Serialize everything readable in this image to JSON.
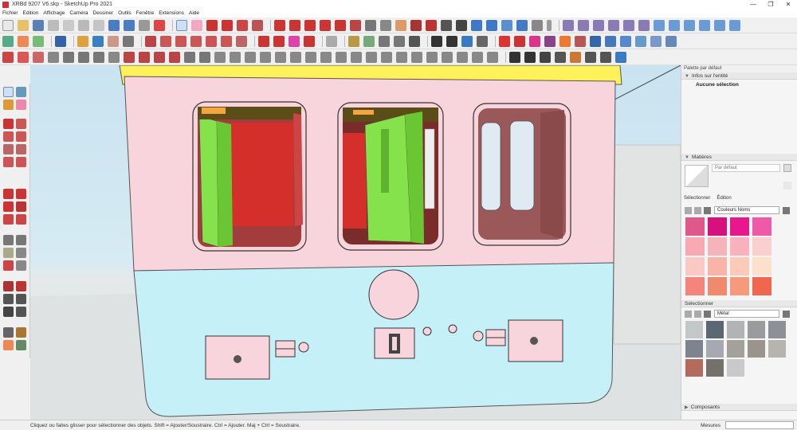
{
  "window": {
    "title": "XRBd 9207 V6.skp - SketchUp Pro 2021",
    "min": "—",
    "max": "❐",
    "close": "✕"
  },
  "menu": [
    "Fichier",
    "Edition",
    "Affichage",
    "Caméra",
    "Dessiner",
    "Outils",
    "Fenêtre",
    "Extensions",
    "Aide"
  ],
  "status": {
    "text": "Cliquez ou faites glisser pour sélectionner des objets. Shift = Ajouter/Soustraire. Ctrl = Ajouter. Maj + Ctrl = Soustraire.",
    "measure_label": "Mesures"
  },
  "tray": {
    "title": "Palette par défaut",
    "entity_info": {
      "header": "Infos sur l'entité",
      "value": "Aucune sélection"
    },
    "materials": {
      "header": "Matières",
      "name": "Par défaut",
      "tab_select": "Sélectionner",
      "tab_edit": "Édition",
      "collection": "Couleurs Noms",
      "swatches": [
        "#e0588a",
        "#d6107e",
        "#e7178c",
        "#ef5aa8",
        "#f9a9b4",
        "#f5b4b9",
        "#f7b2bd",
        "#fad0cf",
        "#fbc9c4",
        "#f9b3a7",
        "#fccab9",
        "#fde0cb",
        "#f4847c",
        "#ef8a6f",
        "#f59b7c",
        "#f1664f"
      ]
    },
    "selector": {
      "header": "Sélectionner",
      "collection": "Métal",
      "swatches": [
        "#c4c7c8",
        "#5c6774",
        "#b2b3b4",
        "#9a9b9c",
        "#8d9096",
        "#7d8490",
        "#a6aab0",
        "#a4a19a",
        "#9a958c",
        "#b6b4af",
        "#b46a5c",
        "#74706a",
        "#c9c9c9"
      ]
    },
    "components": {
      "header": "Composants"
    }
  },
  "colors": {
    "roof": "#fef15a",
    "upper": "#f8d4dd",
    "lower": "#c5f0f7",
    "red": "#d42f2a",
    "green": "#86e24a",
    "ground": "#dfe2e2"
  }
}
